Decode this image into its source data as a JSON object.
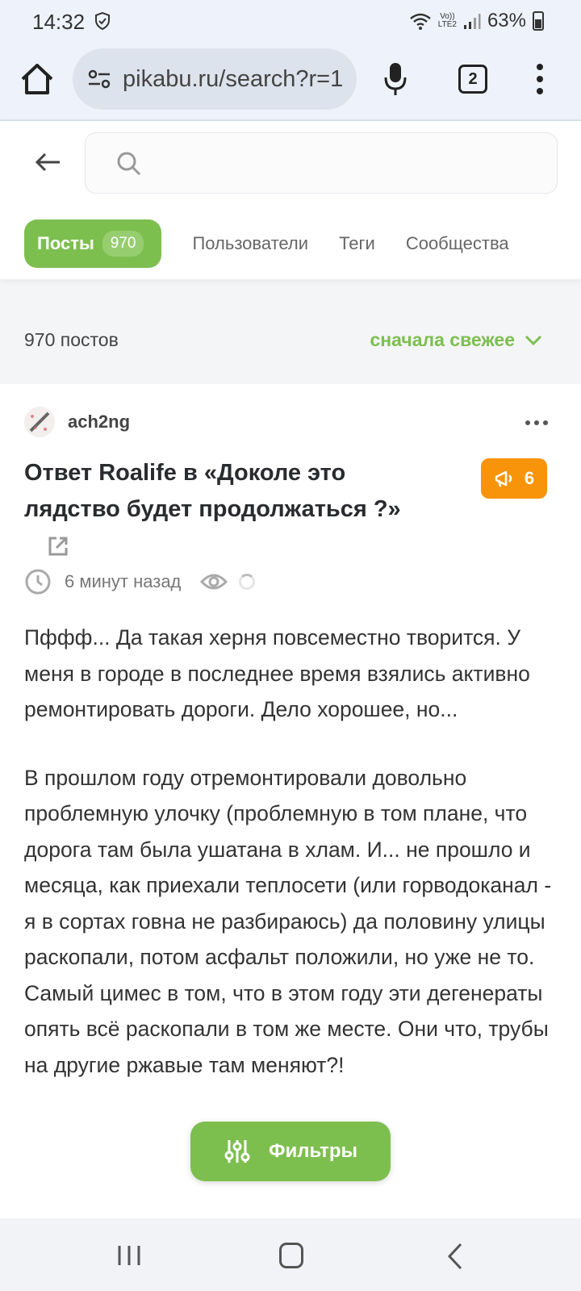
{
  "status_bar": {
    "time": "14:32",
    "lte_top": "Vo))",
    "lte_bottom": "LTE2",
    "battery": "63%"
  },
  "browser": {
    "url": "pikabu.ru/search?r=1",
    "tab_count": "2"
  },
  "search": {
    "placeholder": ""
  },
  "tabs": {
    "posts_label": "Посты",
    "posts_count": "970",
    "users_label": "Пользователи",
    "tags_label": "Теги",
    "communities_label": "Сообщества"
  },
  "results": {
    "count_label": "970 постов",
    "sort_label": "сначала свежее"
  },
  "post": {
    "author": "ach2ng",
    "title": "Ответ Roalife в «Доколе это лядство будет продолжаться ?»",
    "rating": "6",
    "time_ago": "6 минут назад",
    "body_p1": "Пффф... Да такая херня повсеместно творится. У меня в городе в последнее время взялись активно ремонтировать дороги. Дело хорошее, но...",
    "body_p2": "В прошлом году отремонтировали довольно проблемную улочку (проблемную в том плане, что дорога там была ушатана в хлам. И... не прошло и месяца, как приехали теплосети (или горводоканал - я в сортах говна не разбираюсь) да половину улицы раскопали, потом асфальт положили, но уже не то. Самый цимес в том, что в этом году эти дегенераты опять всё раскопали в том же месте. Они что, трубы на другие ржавые там меняют?!"
  },
  "filter_button": {
    "label": "Фильтры"
  },
  "colors": {
    "accent_green": "#7dbf4f",
    "rating_orange": "#f7940a"
  }
}
